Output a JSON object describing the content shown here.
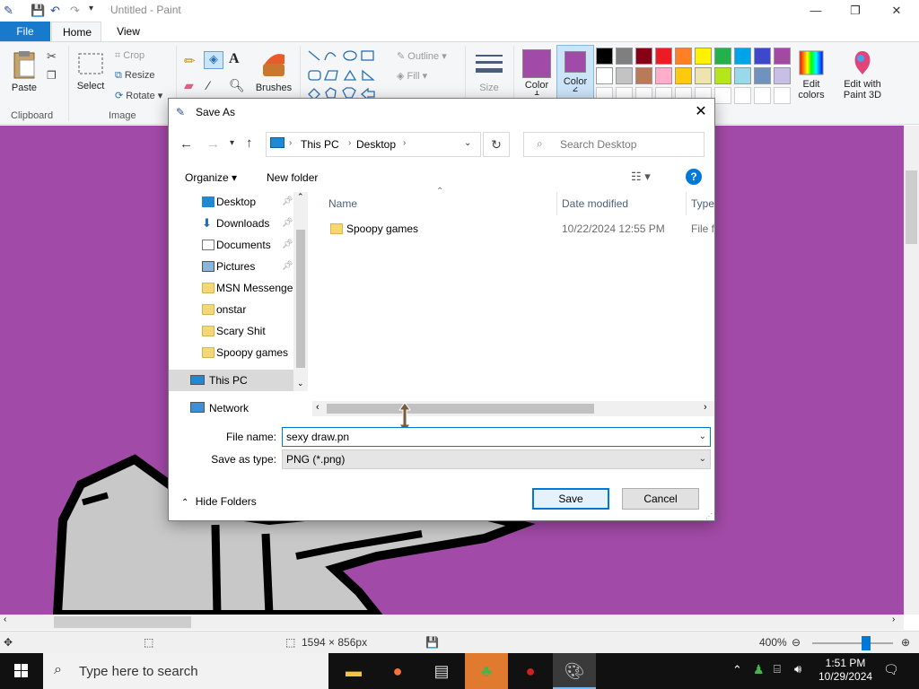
{
  "paint": {
    "title": "Untitled - Paint",
    "tabs": {
      "file": "File",
      "home": "Home",
      "view": "View"
    },
    "clipboard": {
      "paste": "Paste",
      "group": "Clipboard"
    },
    "image": {
      "select": "Select",
      "crop": "Crop",
      "resize": "Resize",
      "rotate": "Rotate",
      "group": "Image"
    },
    "brushes": "Brushes",
    "shapes": {
      "outline": "Outline",
      "fill": "Fill"
    },
    "size": "Size",
    "color1": {
      "label": "Color",
      "number": "1",
      "value": "#a24aa7"
    },
    "color2": {
      "label": "Color",
      "number": "2",
      "value": "#a24aa7"
    },
    "edit_colors": "Edit colors",
    "edit_with": "Edit with Paint 3D",
    "palette": [
      "#000000",
      "#7f7f7f",
      "#880015",
      "#ed1c24",
      "#ff7f27",
      "#fff200",
      "#22b14c",
      "#00a2e8",
      "#3f48cc",
      "#a349a4",
      "#ffffff",
      "#c3c3c3",
      "#b97a57",
      "#ffaec9",
      "#ffc90e",
      "#efe4b0",
      "#b5e61d",
      "#99d9ea",
      "#7092be",
      "#c8bfe7"
    ],
    "status": {
      "dimensions": "1594 × 856px",
      "zoom": "400%"
    },
    "canvas_bg": "#a24aa7"
  },
  "dialog": {
    "title": "Save As",
    "breadcrumb": [
      "This PC",
      "Desktop"
    ],
    "search_placeholder": "Search Desktop",
    "organize": "Organize",
    "new_folder": "New folder",
    "nav": [
      {
        "label": "Desktop",
        "pinned": true,
        "icon": "desktop-icon"
      },
      {
        "label": "Downloads",
        "pinned": true,
        "icon": "download-icon"
      },
      {
        "label": "Documents",
        "pinned": true,
        "icon": "documents-icon"
      },
      {
        "label": "Pictures",
        "pinned": true,
        "icon": "pictures-icon"
      },
      {
        "label": "MSN Messenger",
        "pinned": false,
        "icon": "folder-icon"
      },
      {
        "label": "onstar",
        "pinned": false,
        "icon": "folder-icon"
      },
      {
        "label": "Scary Shit",
        "pinned": false,
        "icon": "folder-icon"
      },
      {
        "label": "Spoopy games",
        "pinned": false,
        "icon": "folder-icon"
      }
    ],
    "this_pc": "This PC",
    "network": "Network",
    "columns": {
      "name": "Name",
      "date": "Date modified",
      "type": "Type"
    },
    "files": [
      {
        "name": "Spoopy games",
        "date": "10/22/2024 12:55 PM",
        "type": "File fo"
      }
    ],
    "file_name_label": "File name:",
    "file_name_value": "sexy draw.pn",
    "save_type_label": "Save as type:",
    "save_type_value": "PNG (*.png)",
    "hide_folders": "Hide Folders",
    "save": "Save",
    "cancel": "Cancel"
  },
  "taskbar": {
    "search_placeholder": "Type here to search",
    "time": "1:51 PM",
    "date": "10/29/2024"
  }
}
